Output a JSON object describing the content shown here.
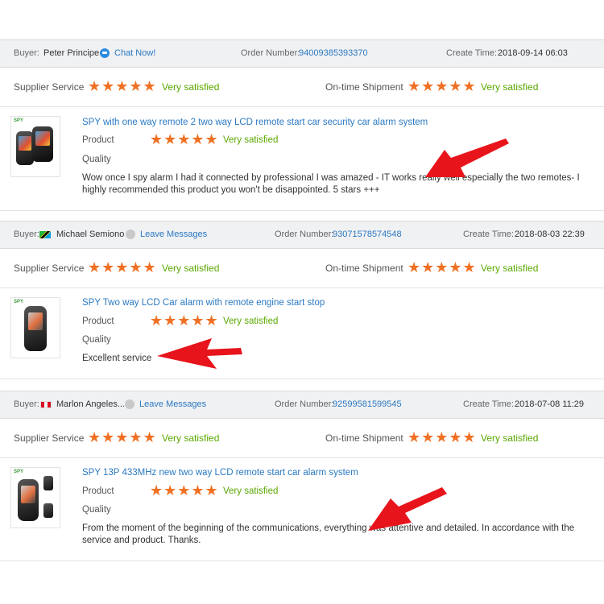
{
  "colors": {
    "star": "#f07023",
    "satisfied": "#5aa800",
    "link": "#2b79c2",
    "bar_bg": "#f0f1f3",
    "arrow": "#e8141b"
  },
  "labels": {
    "buyer": "Buyer:",
    "order_number": "Order Number:",
    "create_time": "Create Time:",
    "supplier_service": "Supplier Service",
    "ontime_shipment": "On-time Shipment",
    "product": "Product",
    "quality": "Quality",
    "stars": "★★★★★",
    "very_satisfied": "Very satisfied"
  },
  "reviews": [
    {
      "buyer": "Peter Principe",
      "contact_action": "Chat Now!",
      "contact_icon": "chat-icon",
      "order_number": "94009385393370",
      "create_time": "2018-09-14 06:03",
      "supplier_rating": 5,
      "shipment_rating": 5,
      "product_rating": 5,
      "product_title": "SPY with one way remote 2 two way LCD remote start car security car alarm system",
      "comment": "Wow once I spy alarm I had it connected by professional I was amazed - IT works really well especially the two remotes- I highly recommended this product you won't be disappointed. 5 stars +++"
    },
    {
      "buyer": "Michael Semiono",
      "flag_icon": "tanzania-flag-icon",
      "contact_action": "Leave Messages",
      "contact_icon": "message-icon",
      "order_number": "93071578574548",
      "create_time": "2018-08-03 22:39",
      "supplier_rating": 5,
      "shipment_rating": 5,
      "product_rating": 5,
      "product_title": "SPY Two way LCD Car alarm with remote engine start stop",
      "comment": "Excellent service"
    },
    {
      "buyer": "Marlon Angeles...",
      "flag_icon": "peru-flag-icon",
      "contact_action": "Leave Messages",
      "contact_icon": "message-icon",
      "order_number": "92599581599545",
      "create_time": "2018-07-08 11:29",
      "supplier_rating": 5,
      "shipment_rating": 5,
      "product_rating": 5,
      "product_title": "SPY 13P 433MHz new two way LCD remote start car alarm system",
      "comment": "From the moment of the beginning of the communications, everything was attentive and detailed. In accordance with the service and product. Thanks."
    }
  ],
  "thumb_brand": "SPY"
}
